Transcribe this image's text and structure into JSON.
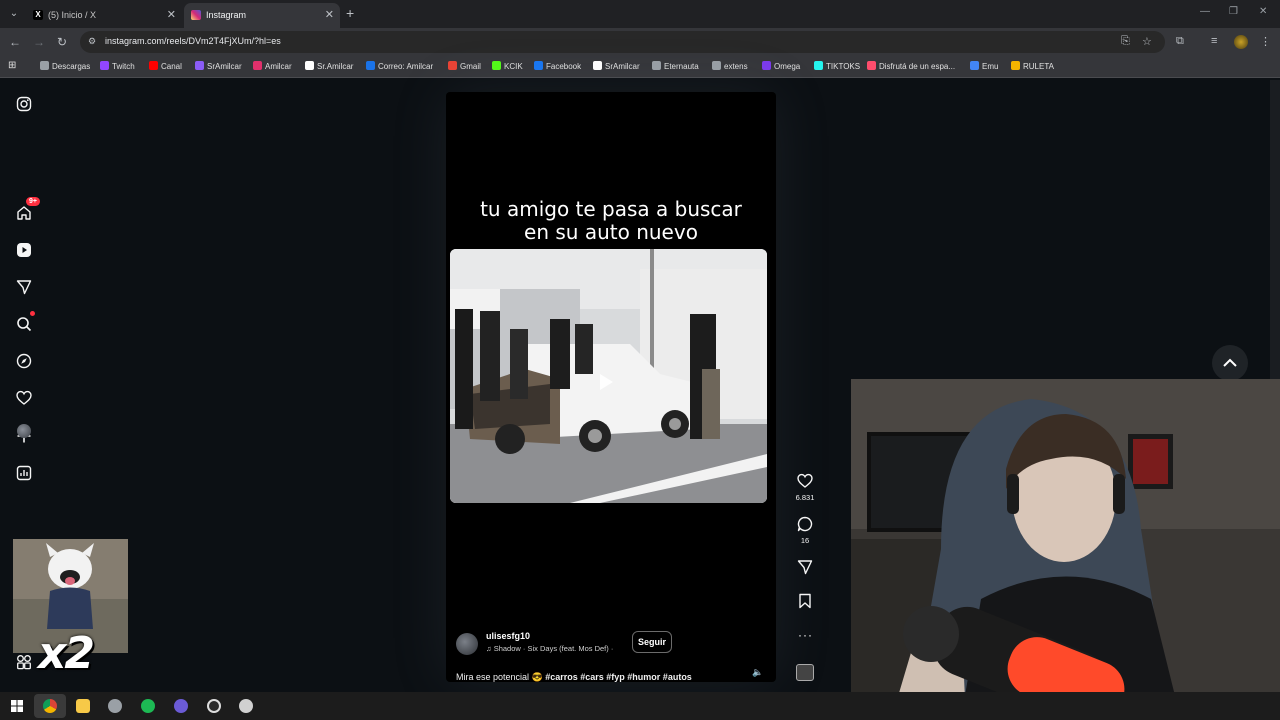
{
  "browser": {
    "tabs": [
      {
        "label": "(5) Inicio / X",
        "active": false
      },
      {
        "label": "Instagram",
        "active": true
      }
    ],
    "url": "instagram.com/reels/DVm2T4FjXUm/?hl=es",
    "bookmarks": [
      "Descargas",
      "Twitch",
      "Canal",
      "SrAmilcar",
      "Amilcar",
      "Sr.Amilcar",
      "Correo: Amilcar",
      "Gmail",
      "KCIK",
      "Facebook",
      "SrAmilcar",
      "Eternauta",
      "extens",
      "Omega",
      "TIKTOKS",
      "Disfrutá de un espa...",
      "Emu",
      "RULETA"
    ],
    "bookmark_colors": [
      "#9aa0a6",
      "#9146ff",
      "#ff0000",
      "#8b5cf6",
      "#e1306c",
      "#ffffff",
      "#1a73e8",
      "#ea4335",
      "#53fc18",
      "#1877f2",
      "#ffffff",
      "#9aa0a6",
      "#9aa0a6",
      "#7c3aed",
      "#25f4ee",
      "#ff4d6d",
      "#4285f4",
      "#f4b400"
    ]
  },
  "sidebar": {
    "icons": [
      "instagram-logo-icon",
      "home-icon",
      "reels-icon",
      "messages-icon",
      "search-icon",
      "explore-icon",
      "notifications-icon",
      "create-icon",
      "dashboard-icon",
      "profile-avatar",
      "more-icon"
    ],
    "messages_badge": "9+"
  },
  "reel": {
    "caption_overlay_line1": "tu amigo te pasa a buscar",
    "caption_overlay_line2": "en su auto nuevo",
    "username": "ulisesfg10",
    "song": "♫ Shadow · Six Days (feat. Mos Def) ·",
    "follow_label": "Seguir",
    "description": "Mira ese potencial 😎 ",
    "hashtags": "#carros #cars #fyp #humor #autos",
    "likes": "6.831",
    "comments": "16"
  },
  "overlays": {
    "multiplier": "x2"
  }
}
